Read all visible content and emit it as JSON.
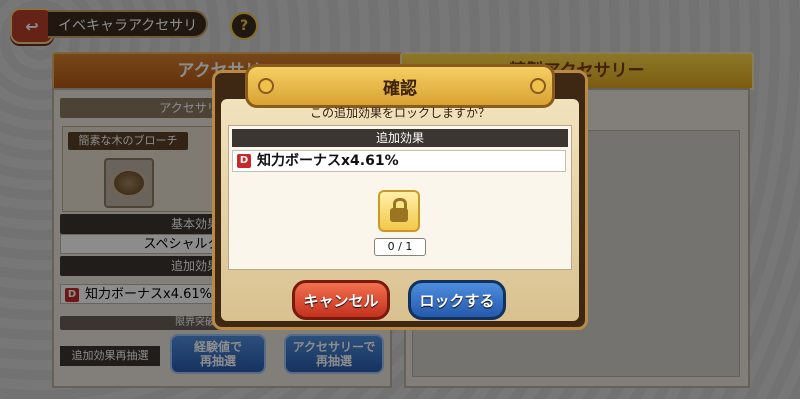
{
  "header": {
    "title": "イベキャラアクセサリー",
    "help_symbol": "?"
  },
  "tabs": [
    {
      "label": "アクセサリー"
    },
    {
      "label": "精製アクセサリー"
    }
  ],
  "left_panel": {
    "section_label": "アクセサリー",
    "item_name": "簡素な木のブローチ",
    "basic_label": "基本効果",
    "basic_value": "スペシャルタック",
    "extra_label": "追加効果",
    "extra_value": "知力ボーナスx4.61%",
    "limit_label": "限界突破",
    "reroll_label": "追加効果再抽選",
    "btn_exp_line1": "経験値で",
    "btn_exp_line2": "再抽選",
    "btn_acc_line1": "アクセサリーで",
    "btn_acc_line2": "再抽選"
  },
  "dialog": {
    "title": "確認",
    "question": "この追加効果をロックしますか？",
    "effect_header": "追加効果",
    "effect_badge": "D",
    "effect_value": "知力ボーナスx4.61%",
    "lock_count": "0 / 1",
    "cancel_label": "キャンセル",
    "lock_label": "ロックする"
  },
  "colors": {
    "cancel": "#c3311d",
    "lock": "#2559ac",
    "badge": "#c7292a"
  }
}
